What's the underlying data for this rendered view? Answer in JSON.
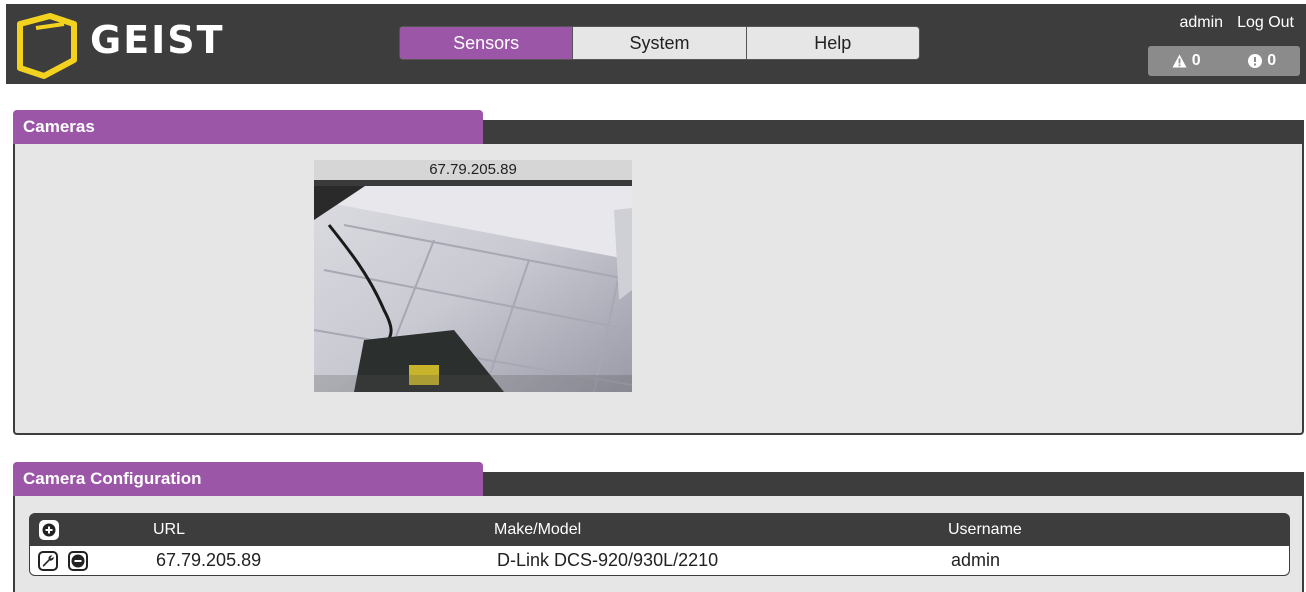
{
  "header": {
    "logo_text": "GEIST",
    "brand_color": "#f2d21e",
    "nav_tabs": [
      {
        "label": "Sensors",
        "active": true
      },
      {
        "label": "System",
        "active": false
      },
      {
        "label": "Help",
        "active": false
      }
    ],
    "user_link": "admin",
    "logout_link": "Log Out",
    "alarms": {
      "warning_count": "0",
      "alarm_count": "0",
      "warning_icon": "warning-triangle-icon",
      "alarm_icon": "alert-circle-icon"
    }
  },
  "accent_color": "#9b56a8",
  "cameras_panel": {
    "title": "Cameras",
    "camera": {
      "caption": "67.79.205.89"
    }
  },
  "config_panel": {
    "title": "Camera Configuration",
    "columns": {
      "url": "URL",
      "make_model": "Make/Model",
      "username": "Username"
    },
    "add_icon": "plus-circle-icon",
    "rows": [
      {
        "url": "67.79.205.89",
        "make_model": "D-Link DCS-920/930L/2210",
        "username": "admin",
        "edit_icon": "wrench-icon",
        "delete_icon": "minus-circle-icon"
      }
    ]
  }
}
